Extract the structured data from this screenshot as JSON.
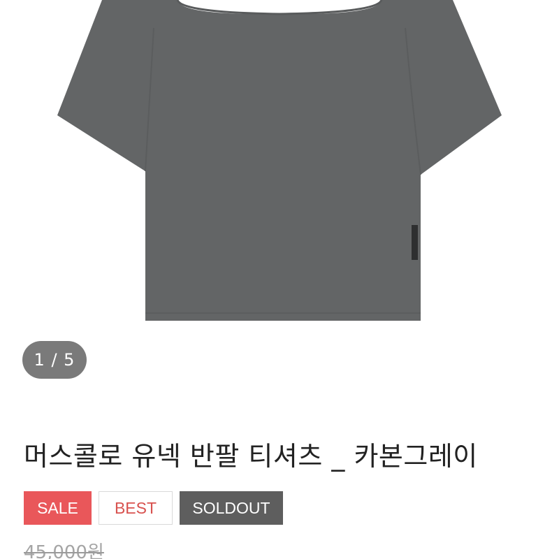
{
  "gallery": {
    "current": "1",
    "total": "5",
    "indicator_text": "1 / 5",
    "image_icon": "tshirt-product-image"
  },
  "product": {
    "title": "머스콜로 유넥 반팔 티셔츠 _ 카본그레이",
    "badges": [
      "SALE",
      "BEST",
      "SOLDOUT"
    ],
    "original_price": "45,000원"
  },
  "colors": {
    "shirt": "#636566",
    "sale": "#e9575a",
    "best_text": "#d8524f",
    "soldout": "#5e5e5e",
    "indicator_bg": "#7a7a7a"
  }
}
